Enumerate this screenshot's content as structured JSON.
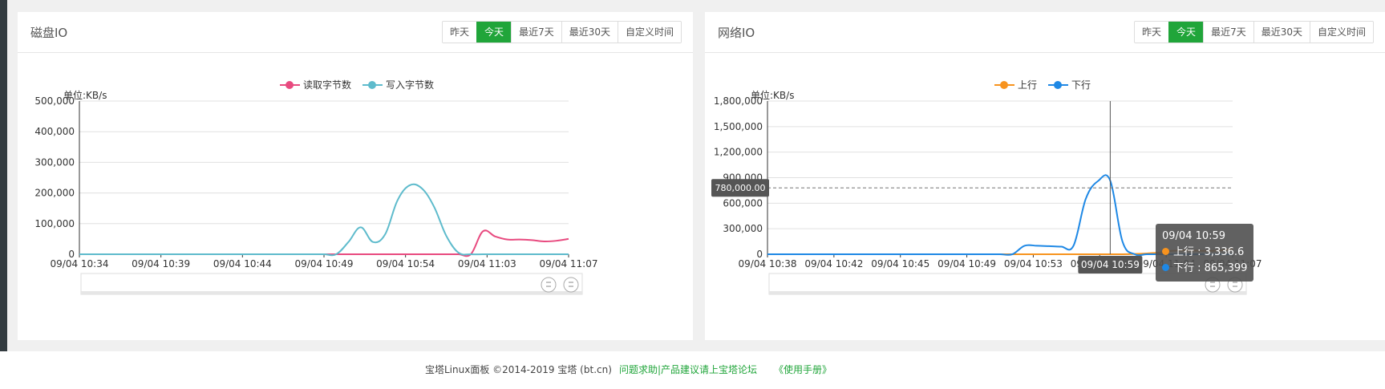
{
  "range_buttons": [
    "昨天",
    "今天",
    "最近7天",
    "最近30天",
    "自定义时间"
  ],
  "active_range": "今天",
  "disk_panel": {
    "title": "磁盘IO",
    "unit": "单位:KB/s",
    "chart_data": {
      "type": "line",
      "legend": [
        "读取字节数",
        "写入字节数"
      ],
      "ylim": [
        0,
        500000
      ],
      "yticks": [
        "500,000",
        "400,000",
        "300,000",
        "200,000",
        "100,000",
        "0"
      ],
      "xticks": [
        "09/04 10:34",
        "09/04 10:39",
        "09/04 10:44",
        "09/04 10:49",
        "09/04 10:54",
        "09/04 11:03",
        "09/04 11:07"
      ],
      "series": [
        {
          "name": "读取字节数",
          "color": "#e84a7f",
          "values": [
            0,
            0,
            0,
            0,
            0,
            0,
            0,
            0,
            0,
            0,
            0,
            0,
            0,
            0,
            0,
            0,
            0,
            0,
            0,
            0,
            0,
            0,
            0,
            0,
            0,
            0,
            0,
            0,
            0,
            0,
            0,
            0,
            0,
            75000,
            58000,
            48000,
            48000,
            46000,
            42000,
            44000,
            50000
          ]
        },
        {
          "name": "写入字节数",
          "color": "#5ebbcc",
          "values": [
            0,
            0,
            0,
            0,
            0,
            0,
            0,
            0,
            0,
            0,
            0,
            0,
            0,
            0,
            0,
            0,
            0,
            0,
            0,
            0,
            0,
            0,
            40000,
            88000,
            40000,
            65000,
            175000,
            225000,
            215000,
            155000,
            60000,
            5000,
            0,
            0,
            0,
            0,
            0,
            0,
            0,
            0,
            0
          ]
        }
      ],
      "grid": true,
      "legend_position": "top-center",
      "has_zoom_slider": true
    }
  },
  "net_panel": {
    "title": "网络IO",
    "unit": "单位:KB/s",
    "chart_data": {
      "type": "line",
      "legend": [
        "上行",
        "下行"
      ],
      "ylim": [
        0,
        1800000
      ],
      "yticks": [
        "1,800,000",
        "1,500,000",
        "1,200,000",
        "900,000",
        "600,000",
        "300,000",
        "0"
      ],
      "xticks": [
        "09/04 10:38",
        "09/04 10:42",
        "09/04 10:45",
        "09/04 10:49",
        "09/04 10:53",
        "09/04 10:59",
        "09/04 11:04",
        "09/04 11:07"
      ],
      "series": [
        {
          "name": "上行",
          "color": "#f7931e",
          "values": [
            0,
            0,
            0,
            0,
            0,
            0,
            0,
            0,
            0,
            0,
            0,
            0,
            0,
            0,
            0,
            0,
            0,
            0,
            0,
            0,
            0,
            0,
            0,
            0,
            0,
            0,
            0,
            0,
            0,
            0,
            3336,
            10000,
            20000,
            40000,
            45000,
            42000,
            40000,
            45000,
            60000
          ]
        },
        {
          "name": "下行",
          "color": "#1e88e5",
          "values": [
            0,
            0,
            0,
            0,
            0,
            0,
            0,
            0,
            0,
            0,
            0,
            0,
            0,
            0,
            0,
            0,
            0,
            0,
            0,
            0,
            0,
            100000,
            100000,
            95000,
            90000,
            100000,
            650000,
            860000,
            865399,
            150000,
            0,
            0,
            0,
            0,
            0,
            0,
            0,
            0,
            0
          ]
        }
      ],
      "crosshair_label": "780,000.00",
      "axis_pointer_label": "09/04 10:59",
      "grid": true,
      "legend_position": "top-center",
      "has_zoom_slider": true
    },
    "tooltip": {
      "time": "09/04 10:59",
      "rows": [
        {
          "label": "上行 : 3,336.6",
          "color": "#f7931e"
        },
        {
          "label": "下行 : 865,399",
          "color": "#1e88e5"
        }
      ]
    }
  },
  "footer": {
    "copyright": "宝塔Linux面板 ©2014-2019 宝塔 (bt.cn)",
    "forum_link": "问题求助|产品建议请上宝塔论坛",
    "manual_link": "《使用手册》"
  }
}
